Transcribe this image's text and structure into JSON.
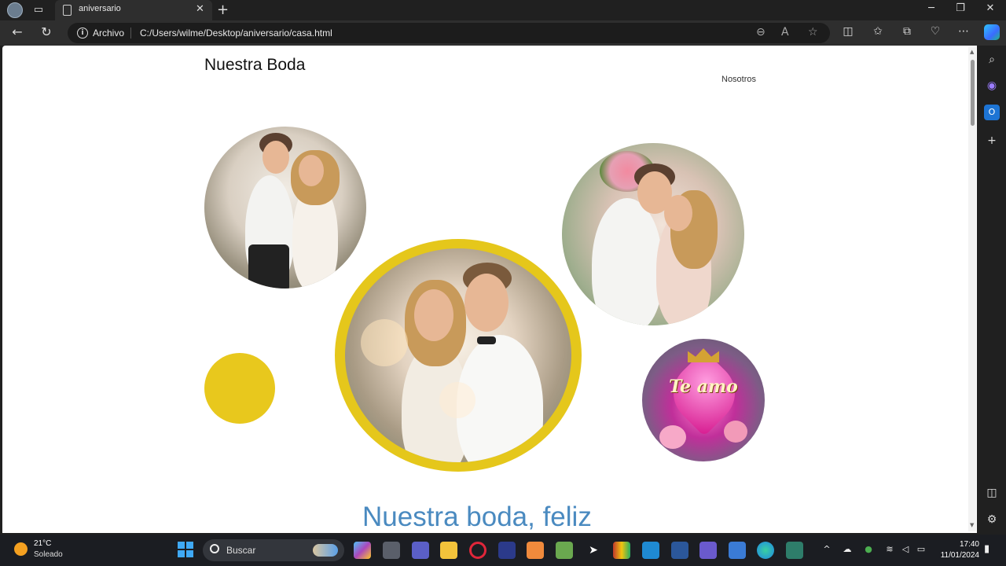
{
  "browser": {
    "tab_title": "aniversario",
    "address_label": "Archivo",
    "url": "C:/Users/wilme/Desktop/aniversario/casa.html",
    "icons": [
      "profile-icon",
      "tab-actions-icon",
      "page-icon",
      "close-icon",
      "plus-icon",
      "minimize-icon",
      "restore-icon",
      "window-close-icon",
      "back-icon",
      "refresh-icon",
      "info-icon",
      "zoom-out-icon",
      "read-aloud-icon",
      "favorite-star-icon",
      "split-screen-icon",
      "favorites-icon",
      "collections-icon",
      "browser-essentials-icon",
      "more-icon",
      "copilot-icon"
    ]
  },
  "page": {
    "site_title": "Nuestra Boda",
    "nav_link": "Nosotros",
    "headline": "Nuestra boda, feliz",
    "heart_text": "Te amo",
    "accent_yellow": "#e5c71b",
    "headline_color": "#4a8ac0"
  },
  "sidebar": {
    "icons": [
      "search-icon",
      "copilot-sidebar-icon",
      "outlook-icon",
      "add-icon",
      "sidebar-toggle-icon",
      "settings-icon"
    ]
  },
  "taskbar": {
    "temperature": "21°C",
    "condition": "Soleado",
    "search_placeholder": "Buscar",
    "time": "17:40",
    "date": "11/01/2024"
  }
}
